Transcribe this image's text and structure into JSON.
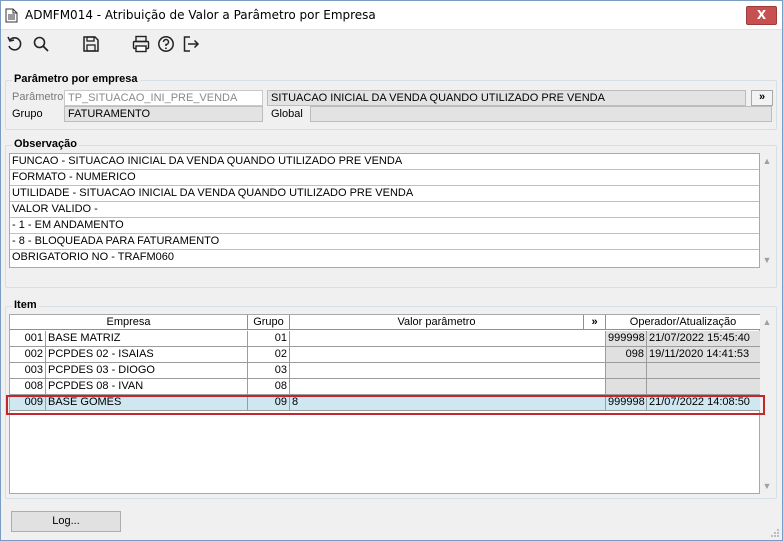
{
  "window": {
    "title": "ADMFM014 - Atribuição de Valor a Parâmetro por Empresa",
    "close_label": "X"
  },
  "toolbar": {
    "icons": [
      "undo-icon",
      "search-icon",
      "save-icon",
      "print-icon",
      "help-icon",
      "exit-icon"
    ]
  },
  "parametro": {
    "legend": "Parâmetro por empresa",
    "parametro_label": "Parâmetro",
    "parametro_value": "TP_SITUACAO_INI_PRE_VENDA",
    "descricao_value": "SITUACAO INICIAL DA VENDA QUANDO UTILIZADO PRE VENDA",
    "more_label": "»",
    "grupo_label": "Grupo",
    "grupo_value": "FATURAMENTO",
    "global_label": "Global",
    "global_value": ""
  },
  "observacao": {
    "legend": "Observação",
    "lines": [
      "FUNCAO - SITUACAO INICIAL DA VENDA QUANDO UTILIZADO PRE VENDA",
      "FORMATO - NUMERICO",
      "UTILIDADE -  SITUACAO INICIAL DA VENDA QUANDO UTILIZADO PRE VENDA",
      "VALOR VALIDO -",
      "- 1 - EM ANDAMENTO",
      "- 8 - BLOQUEADA PARA FATURAMENTO",
      "OBRIGATORIO NO - TRAFM060"
    ]
  },
  "item": {
    "legend": "Item",
    "columns": {
      "empresa": "Empresa",
      "grupo": "Grupo",
      "valor": "Valor parâmetro",
      "more": "»",
      "operador": "Operador/Atualização"
    },
    "rows": [
      {
        "code": "001",
        "empresa": "BASE MATRIZ",
        "grupo": "01",
        "valor": "",
        "operador": "999998",
        "atualizacao": "21/07/2022 15:45:40"
      },
      {
        "code": "002",
        "empresa": "PCPDES 02 - ISAIAS",
        "grupo": "02",
        "valor": "",
        "operador": "098",
        "atualizacao": "19/11/2020 14:41:53"
      },
      {
        "code": "003",
        "empresa": "PCPDES 03 - DIOGO",
        "grupo": "03",
        "valor": "",
        "operador": "",
        "atualizacao": ""
      },
      {
        "code": "008",
        "empresa": "PCPDES 08 - IVAN",
        "grupo": "08",
        "valor": "",
        "operador": "",
        "atualizacao": ""
      },
      {
        "code": "009",
        "empresa": "BASE GOMES",
        "grupo": "09",
        "valor": "8",
        "operador": "999998",
        "atualizacao": "21/07/2022 14:08:50"
      }
    ]
  },
  "footer": {
    "log_label": "Log..."
  }
}
